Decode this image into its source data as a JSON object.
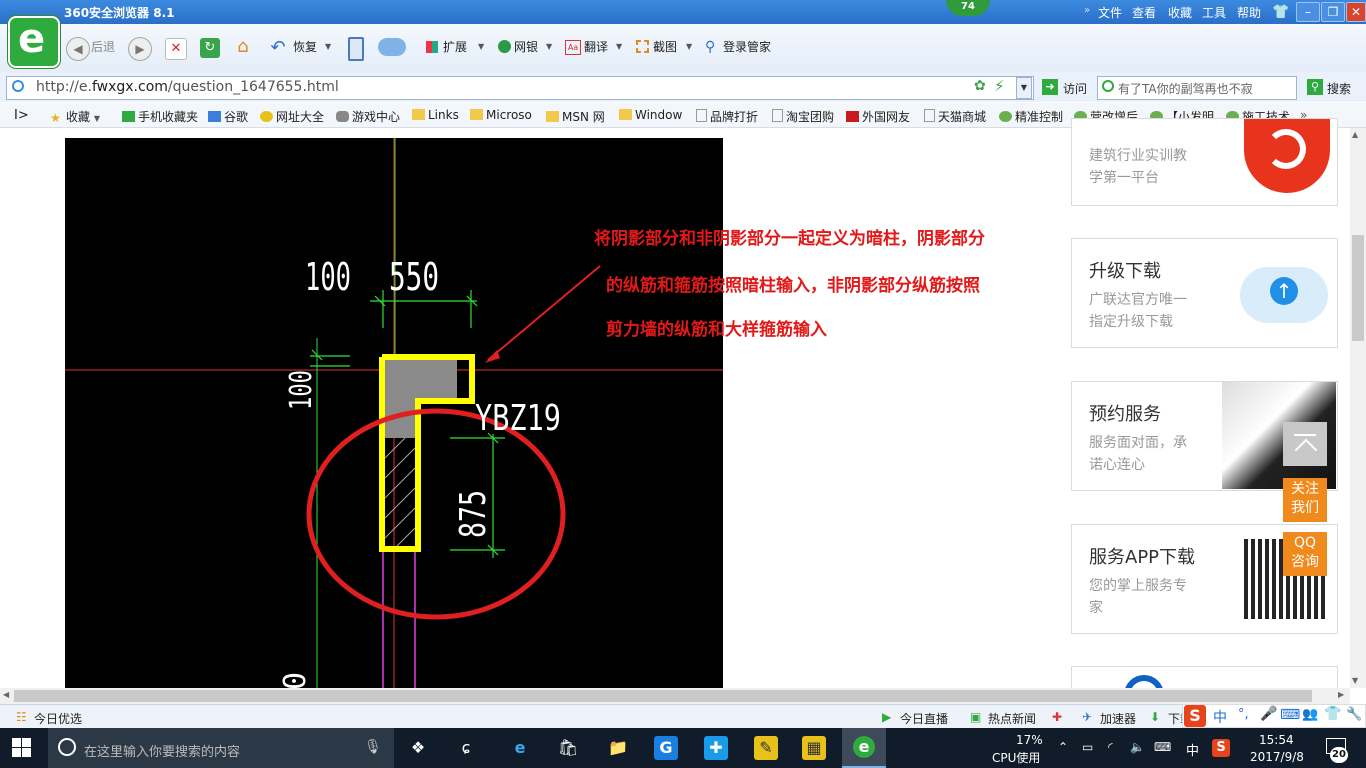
{
  "window": {
    "title": "360安全浏览器 8.1",
    "menu": [
      "文件",
      "查看",
      "收藏",
      "工具",
      "帮助"
    ],
    "badge": "74"
  },
  "toolbar": {
    "back_label": "后退",
    "restore_label": "恢复",
    "extensions_label": "扩展",
    "netbank_label": "网银",
    "translate_label": "翻译",
    "screenshot_label": "截图",
    "login_label": "登录管家"
  },
  "address": {
    "url_prefix": "http://e.",
    "url_domain": "fwxgx.com",
    "url_path": "/question_1647655.html",
    "go_label": "访问",
    "search_placeholder": "有了TA你的副驾再也不寂",
    "search_label": "搜索"
  },
  "bookmarks": [
    "收藏",
    "手机收藏夹",
    "谷歌",
    "网址大全",
    "游戏中心",
    "Links",
    "Microso",
    "MSN 网",
    "Window",
    "品牌打折",
    "淘宝团购",
    "外国网友",
    "天猫商城",
    "精准控制",
    "营改增后",
    "【小发明",
    "施工技术"
  ],
  "drawing": {
    "dim_100_top": "100",
    "dim_550": "550",
    "dim_100_left": "100",
    "label_ybz": "YBZ19",
    "dim_875": "875"
  },
  "annotation": {
    "line1": "将阴影部分和非阴影部分一起定义为暗柱，阴影部分",
    "line2": "的纵筋和箍筋按照暗柱输入，非阴影部分纵筋按照",
    "line3": "剪力墙的纵筋和大样箍筋输入"
  },
  "sidebar": {
    "card0_desc1": "建筑行业实训教",
    "card0_desc2": "学第一平台",
    "upgrade_title": "升级下载",
    "upgrade_desc1": "广联达官方唯一",
    "upgrade_desc2": "指定升级下载",
    "service_title": "预约服务",
    "service_desc1": "服务面对面，承",
    "service_desc2": "诺心连心",
    "app_title": "服务APP下载",
    "app_desc1": "您的掌上服务专",
    "app_desc2": "家",
    "follow_label": [
      "关注",
      "我们"
    ],
    "qq_label": [
      "QQ",
      "咨询"
    ]
  },
  "statusbar": {
    "today_picks": "今日优选",
    "today_live": "今日直播",
    "hot_news": "热点新闻",
    "accelerator": "加速器",
    "download": "下载"
  },
  "taskbar": {
    "search_placeholder": "在这里输入你要搜索的内容",
    "cpu_percent": "17%",
    "cpu_label": "CPU使用",
    "ime": "中",
    "time": "15:54",
    "date": "2017/9/8",
    "notifications": "20"
  },
  "colors": {
    "annotation": "#e21919",
    "accent_orange": "#f08a1c",
    "titlebar": "#2a6fc8",
    "cad_yellow": "#ffff00"
  }
}
